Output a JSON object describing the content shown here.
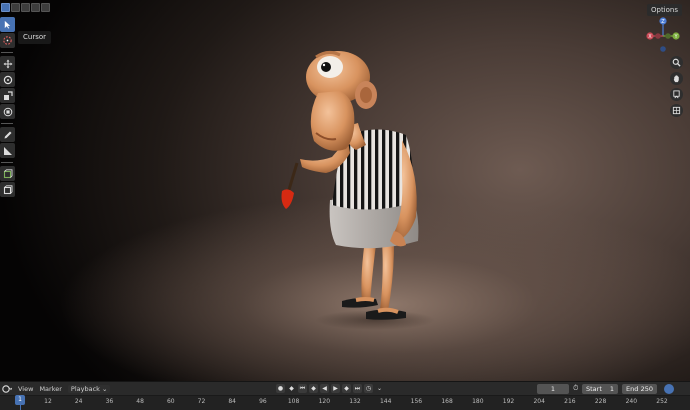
{
  "viewport": {
    "options_label": "Options",
    "tooltip": "Cursor",
    "gizmo": {
      "z_label": "Z",
      "y_label": "Y",
      "x_label": "X"
    },
    "colors": {
      "x_axis": "#c94a56",
      "y_axis": "#7cad3e",
      "z_axis": "#4c7cd4",
      "active": "#4772b3"
    }
  },
  "timeline": {
    "view_label": "View",
    "marker_label": "Marker",
    "playback_label": "Playback",
    "current_frame": "1",
    "start_label": "Start",
    "start_value": "1",
    "end_label": "End",
    "end_value": "250",
    "frame_marker": "1",
    "ticks": [
      "12",
      "24",
      "36",
      "48",
      "60",
      "72",
      "84",
      "96",
      "108",
      "120",
      "132",
      "144",
      "156",
      "168",
      "180",
      "192",
      "204",
      "216",
      "228",
      "240",
      "252"
    ]
  }
}
